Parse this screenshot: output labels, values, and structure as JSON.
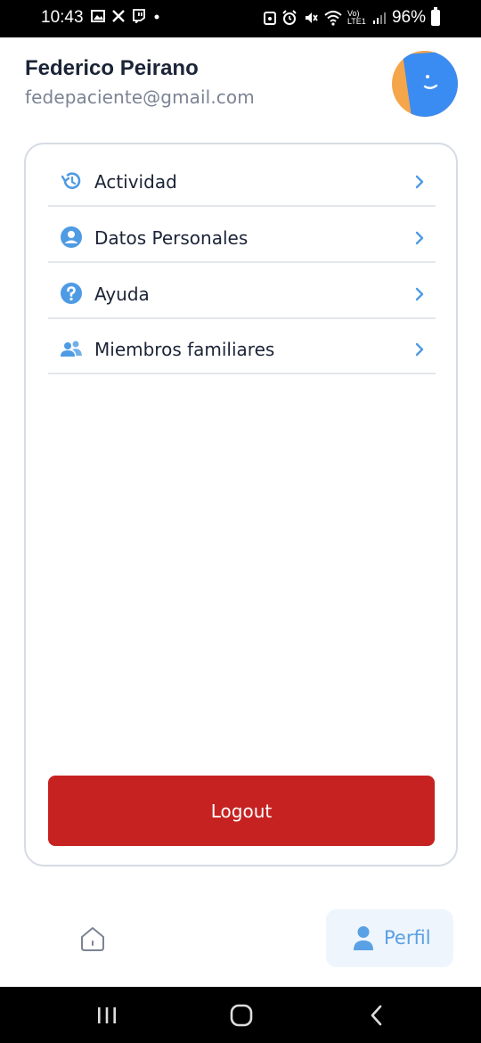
{
  "status_bar": {
    "time": "10:43",
    "left_icons": [
      "image-icon",
      "x-logo-icon",
      "twitch-icon",
      "dot-icon"
    ],
    "right_icons": [
      "nfc-icon",
      "alarm-icon",
      "mute-icon",
      "wifi-icon",
      "volte-icon",
      "signal-icon"
    ],
    "volte_label": "Vo) LTE1",
    "battery": "96%"
  },
  "profile": {
    "name": "Federico Peirano",
    "email": "fedepaciente@gmail.com"
  },
  "menu": [
    {
      "label": "Actividad",
      "icon": "history-icon"
    },
    {
      "label": "Datos Personales",
      "icon": "account-circle-icon"
    },
    {
      "label": "Ayuda",
      "icon": "help-circle-icon"
    },
    {
      "label": "Miembros familiares",
      "icon": "people-icon"
    }
  ],
  "logout_label": "Logout",
  "bottom_tabs": {
    "home_icon": "home-icon",
    "profile_label": "Perfil",
    "profile_icon": "person-icon"
  },
  "colors": {
    "accent": "#5aa0e4",
    "icon_blue": "#4f9be3",
    "logout": "#c62222",
    "text": "#1b2437",
    "muted": "#7b8494",
    "avatar_blue": "#3b8cf2",
    "avatar_orange": "#f5a54a"
  }
}
